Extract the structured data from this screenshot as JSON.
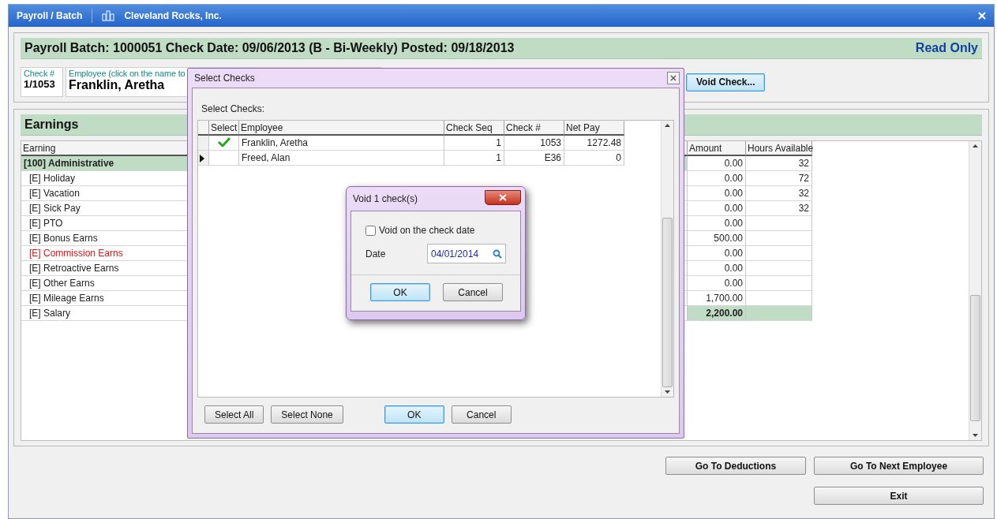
{
  "window": {
    "title": "Payroll / Batch",
    "company": "Cleveland Rocks, Inc."
  },
  "header": {
    "title": "Payroll Batch: 1000051 Check Date: 09/06/2013 (B - Bi-Weekly) Posted: 09/18/2013",
    "status": "Read Only",
    "check_label": "Check #",
    "check_value": "1/1053",
    "employee_label": "Employee (click on the name to",
    "employee_value": "Franklin, Aretha",
    "void_button": "Void Check..."
  },
  "earnings": {
    "title": "Earnings",
    "columns": [
      "Earning",
      "Amount",
      "Hours Available"
    ],
    "rows": [
      {
        "kind": "group",
        "name": "[100] Administrative",
        "amount": "0.00",
        "hours": "32",
        "flagged": false,
        "total": false
      },
      {
        "kind": "item",
        "name": "[E] Holiday",
        "amount": "0.00",
        "hours": "72",
        "flagged": false,
        "total": false
      },
      {
        "kind": "item",
        "name": "[E] Vacation",
        "amount": "0.00",
        "hours": "32",
        "flagged": false,
        "total": false
      },
      {
        "kind": "item",
        "name": "[E] Sick Pay",
        "amount": "0.00",
        "hours": "32",
        "flagged": false,
        "total": false
      },
      {
        "kind": "item",
        "name": "[E] PTO",
        "amount": "0.00",
        "hours": "",
        "flagged": false,
        "total": false
      },
      {
        "kind": "item",
        "name": "[E] Bonus Earns",
        "amount": "500.00",
        "hours": "",
        "flagged": false,
        "total": false
      },
      {
        "kind": "item",
        "name": "[E] Commission Earns",
        "amount": "0.00",
        "hours": "",
        "flagged": true,
        "total": false
      },
      {
        "kind": "item",
        "name": "[E] Retroactive Earns",
        "amount": "0.00",
        "hours": "",
        "flagged": false,
        "total": false
      },
      {
        "kind": "item",
        "name": "[E] Other Earns",
        "amount": "0.00",
        "hours": "",
        "flagged": false,
        "total": false
      },
      {
        "kind": "item",
        "name": "[E] Mileage Earns",
        "amount": "1,700.00",
        "hours": "",
        "flagged": false,
        "total": false
      },
      {
        "kind": "item",
        "name": "[E] Salary",
        "amount": "2,200.00",
        "hours": "",
        "flagged": false,
        "total": true
      }
    ]
  },
  "buttons": {
    "deductions": "Go To Deductions",
    "next": "Go To Next Employee",
    "exit": "Exit"
  },
  "select_dialog": {
    "title": "Select Checks",
    "label": "Select Checks:",
    "columns": [
      "Select",
      "Employee",
      "Check Seq",
      "Check #",
      "Net Pay"
    ],
    "rows": [
      {
        "checked": true,
        "current": false,
        "employee": "Franklin, Aretha",
        "seq": "1",
        "check": "1053",
        "net": "1272.48"
      },
      {
        "checked": false,
        "current": true,
        "employee": "Freed, Alan",
        "seq": "1",
        "check": "E36",
        "net": "0"
      }
    ],
    "buttons": [
      {
        "label": "Select All",
        "default": false
      },
      {
        "label": "Select None",
        "default": false
      },
      {
        "label": "OK",
        "default": true
      },
      {
        "label": "Cancel",
        "default": false
      }
    ]
  },
  "void_dialog": {
    "title": "Void 1 check(s)",
    "checkbox": {
      "label": "Void on the check date",
      "checked": false
    },
    "date_label": "Date",
    "date_value": "04/01/2014",
    "buttons": [
      {
        "label": "OK",
        "default": true
      },
      {
        "label": "Cancel",
        "default": false
      }
    ]
  }
}
